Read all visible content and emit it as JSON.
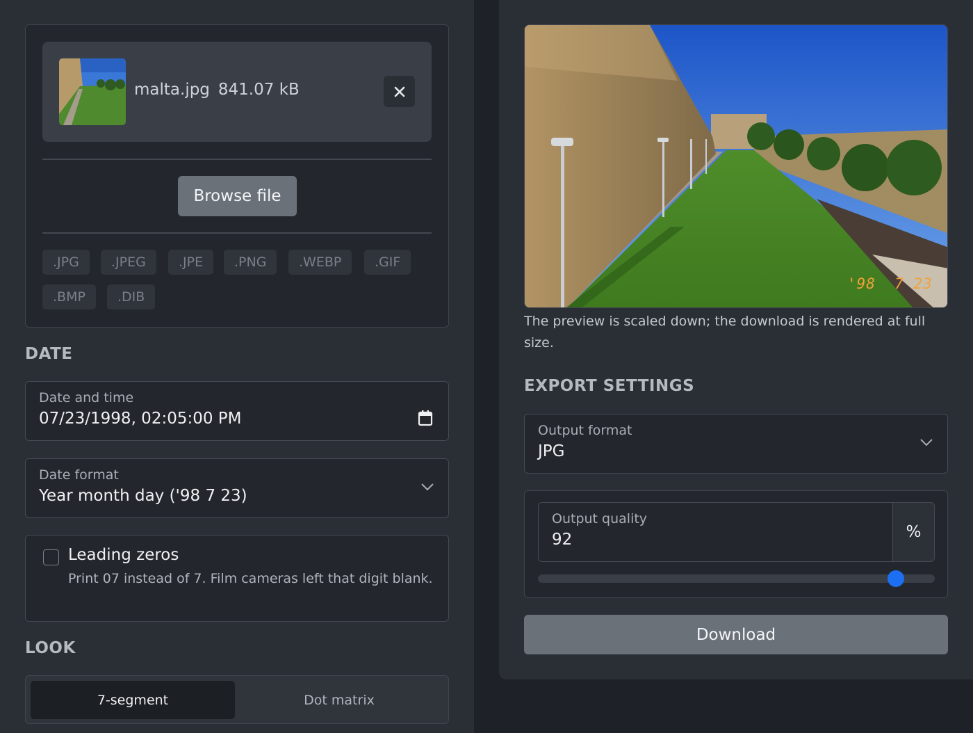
{
  "upload": {
    "file_name": "malta.jpg",
    "file_size": "841.07 kB",
    "browse_label": "Browse file",
    "extensions": [
      ".JPG",
      ".JPEG",
      ".JPE",
      ".PNG",
      ".WEBP",
      ".GIF",
      ".BMP",
      ".DIB"
    ]
  },
  "date": {
    "section_title": "DATE",
    "datetime_label": "Date and time",
    "datetime_value": "07/23/1998, 02:05:00 PM",
    "format_label": "Date format",
    "format_value": "Year month day ('98 7 23)",
    "leading_zeros_label": "Leading zeros",
    "leading_zeros_desc": "Print 07 instead of 7. Film cameras left that digit blank.",
    "leading_zeros_checked": false
  },
  "look": {
    "section_title": "LOOK",
    "options": [
      "7-segment",
      "Dot matrix"
    ],
    "selected": "7-segment"
  },
  "preview": {
    "stamp_text": "'98  7 23",
    "stamp_color": "#f0a23a",
    "note": "The preview is scaled down; the download is rendered at full size."
  },
  "export": {
    "section_title": "EXPORT SETTINGS",
    "format_label": "Output format",
    "format_value": "JPG",
    "quality_label": "Output quality",
    "quality_value": "92",
    "quality_unit": "%",
    "quality_fraction": 0.92,
    "download_label": "Download"
  },
  "colors": {
    "accent": "#1d6ff2",
    "button": "#6a7179"
  }
}
